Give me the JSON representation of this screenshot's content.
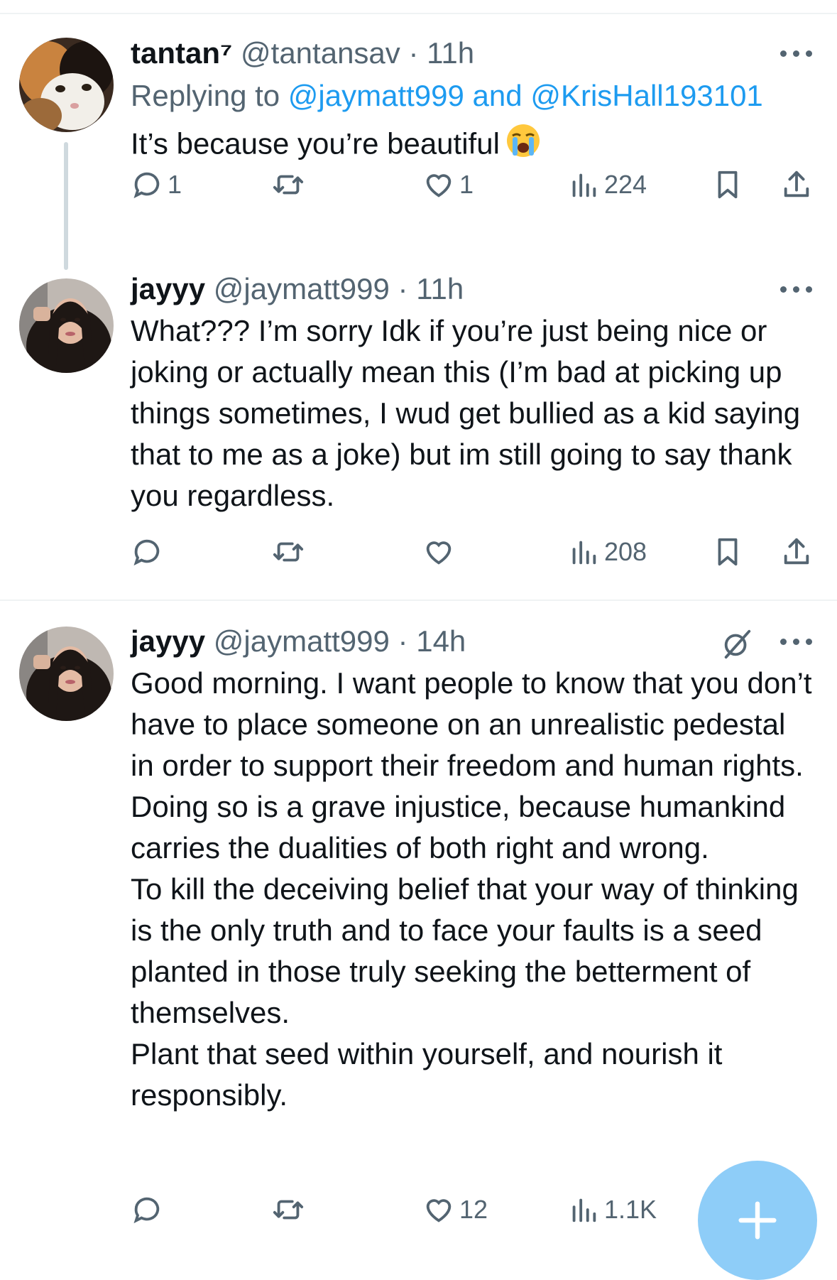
{
  "tweets": [
    {
      "name": "tantan⁷",
      "handle": "@tantansav",
      "separator": "·",
      "time": "11h",
      "replying_prefix": "Replying to ",
      "replying_user1": "@jaymatt999",
      "replying_and": " and ",
      "replying_user2": "@KrisHall193101",
      "text": "It’s because you’re beautiful",
      "emoji": "crying-face-emoji",
      "replies": "1",
      "retweets": "",
      "likes": "1",
      "views": "224"
    },
    {
      "name": "jayyy",
      "handle": "@jaymatt999",
      "separator": "·",
      "time": "11h",
      "text": "What??? I’m sorry Idk if you’re just being nice or joking or actually mean this (I’m bad at picking up things sometimes, I wud get bullied as a kid saying that to me as a joke) but im still going to say thank you regardless.",
      "replies": "",
      "retweets": "",
      "likes": "",
      "views": "208"
    },
    {
      "name": "jayyy",
      "handle": "@jaymatt999",
      "separator": "·",
      "time": "14h",
      "text": "Good morning. I want people to know that you don’t have to place someone on an unrealistic pedestal in order to support their freedom and human rights.\nDoing so is a grave injustice, because humankind carries the dualities of both right and wrong.\nTo kill the deceiving belief that your way of thinking is the only truth and to face your faults is a seed planted in those truly seeking the betterment of themselves.\nPlant that seed within yourself, and nourish it responsibly.",
      "replies": "",
      "retweets": "",
      "likes": "12",
      "views": "1.1K"
    }
  ],
  "colors": {
    "accent": "#1d9bf0",
    "muted": "#536471",
    "fab": "#8ecdf8"
  }
}
